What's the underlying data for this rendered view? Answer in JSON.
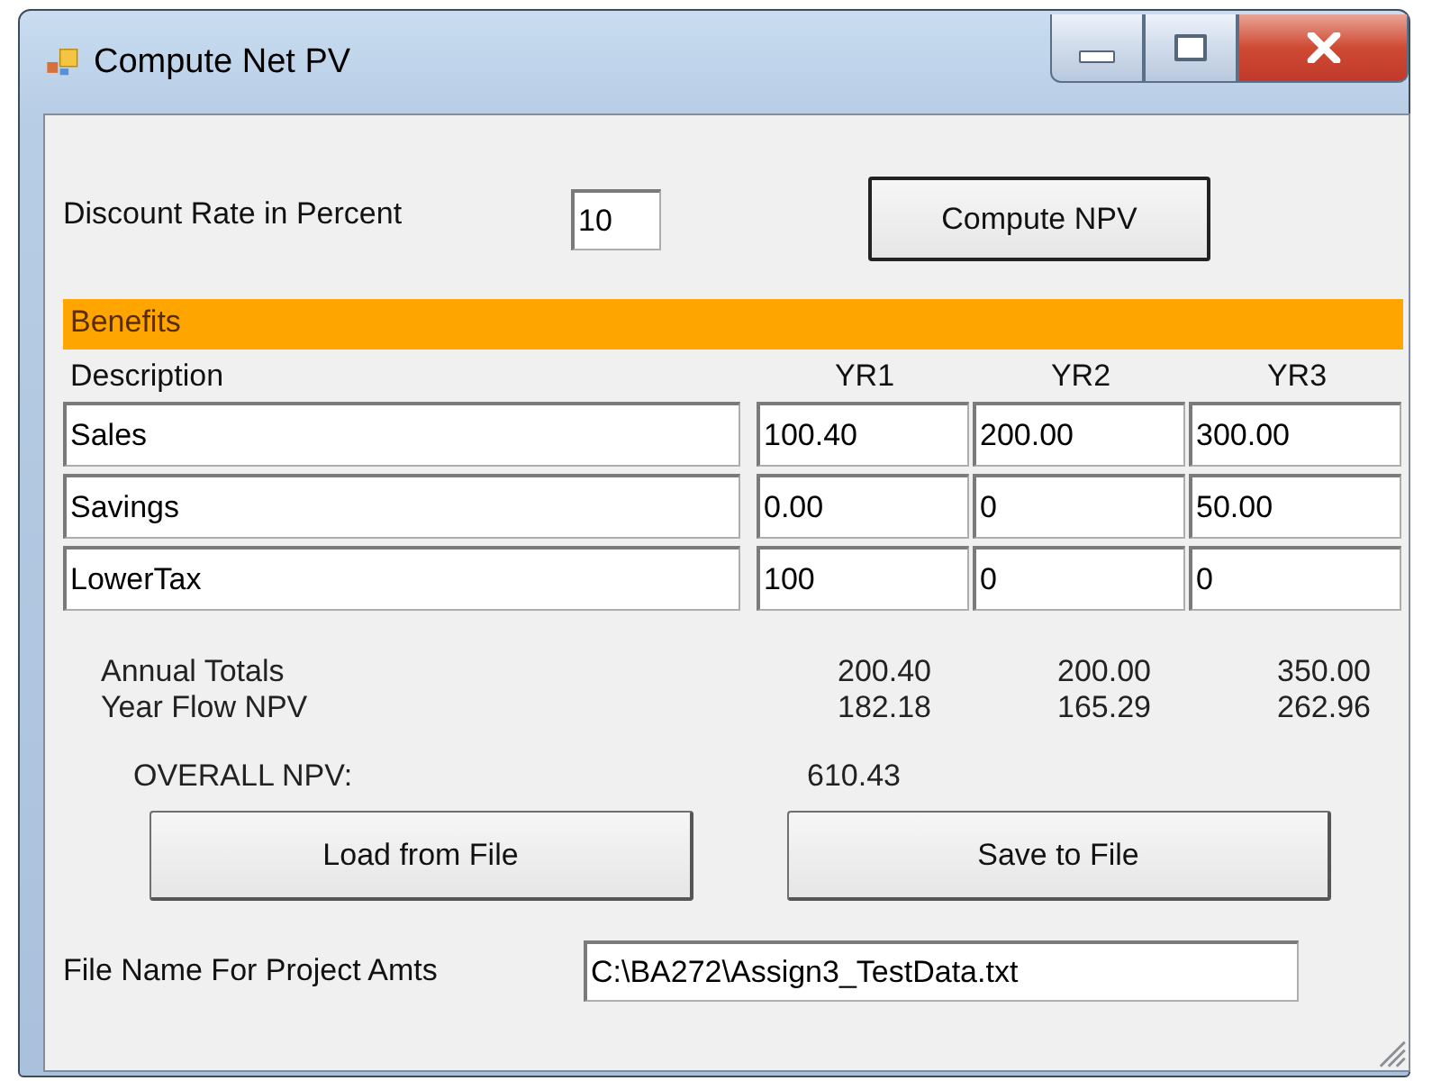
{
  "window": {
    "title": "Compute Net PV"
  },
  "discount": {
    "label": "Discount Rate in Percent",
    "value": "10"
  },
  "compute_button": "Compute NPV",
  "benefits": {
    "title": "Benefits",
    "columns": [
      "Description",
      "YR1",
      "YR2",
      "YR3"
    ],
    "rows": [
      {
        "description": "Sales",
        "values": [
          "100.40",
          "200.00",
          "300.00"
        ]
      },
      {
        "description": "Savings",
        "values": [
          "0.00",
          "0",
          "50.00"
        ]
      },
      {
        "description": "LowerTax",
        "values": [
          "100",
          "0",
          "0"
        ]
      }
    ]
  },
  "annual_totals": {
    "label": "Annual Totals",
    "values": [
      "200.40",
      "200.00",
      "350.00"
    ]
  },
  "year_flow_npv": {
    "label": "Year Flow NPV",
    "values": [
      "182.18",
      "165.29",
      "262.96"
    ]
  },
  "overall_npv": {
    "label": "OVERALL NPV:",
    "value": "610.43"
  },
  "buttons": [
    "Load from File",
    "Save to File"
  ],
  "file": {
    "label": "File Name For Project Amts",
    "value": "C:\\BA272\\Assign3_TestData.txt"
  }
}
